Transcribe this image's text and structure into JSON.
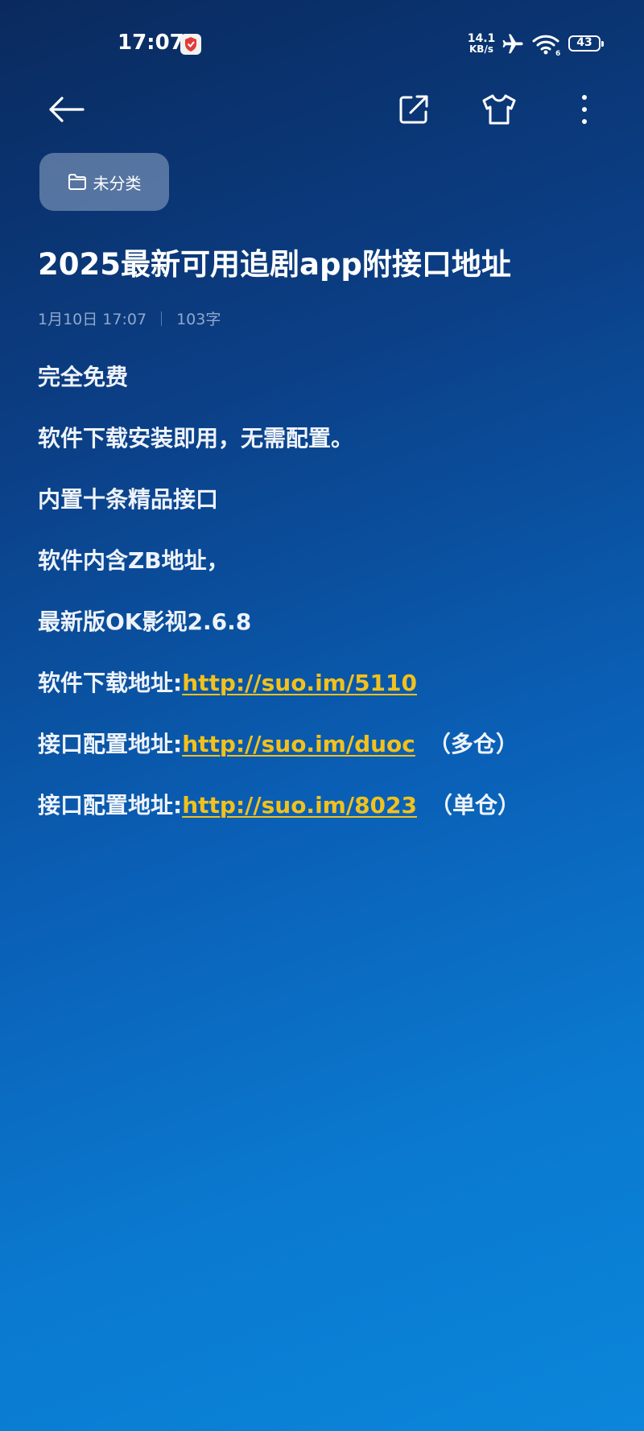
{
  "status_bar": {
    "time": "17:07",
    "net_speed_value": "14.1",
    "net_speed_unit": "KB/s",
    "battery_level": "43",
    "wifi_index": "6"
  },
  "toolbar": {
    "back_icon": "arrow-left-icon",
    "share_icon": "share-export-icon",
    "theme_icon": "tshirt-theme-icon",
    "more_icon": "more-vertical-icon"
  },
  "note": {
    "folder_label": "未分类",
    "title": "2025最新可用追剧app附接口地址",
    "date": "1月10日 17:07",
    "word_count": "103字",
    "lines": [
      {
        "text": "完全免费"
      },
      {
        "text": "软件下载安装即用，无需配置。"
      },
      {
        "text": "内置十条精品接口"
      },
      {
        "text": "软件内含ZB地址，"
      },
      {
        "text": "最新版OK影视2.6.8"
      },
      {
        "prefix": "软件下载地址:",
        "link": "http://suo.im/5110",
        "suffix": ""
      },
      {
        "prefix": "接口配置地址:",
        "link": "http://suo.im/duoc",
        "suffix": "（多仓）"
      },
      {
        "prefix": "接口配置地址:",
        "link": "http://suo.im/8023",
        "suffix": "（单仓）"
      }
    ]
  },
  "colors": {
    "link": "#f2c11c",
    "text": "#eef3fa",
    "meta": "#bccde6"
  }
}
